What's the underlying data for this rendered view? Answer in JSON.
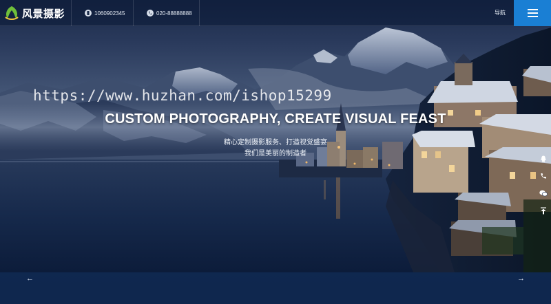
{
  "brand": {
    "name": "风景摄影"
  },
  "header": {
    "phone_mobile": "1060902345",
    "phone_landline": "020-88888888",
    "nav_label": "导航"
  },
  "watermark": "https://www.huzhan.com/ishop15299",
  "hero": {
    "headline": "CUSTOM PHOTOGRAPHY, CREATE VISUAL FEAST",
    "subline_1": "精心定制摄影服务、打造视觉盛宴",
    "subline_2": "我们是美丽的制造者"
  },
  "slider": {
    "prev_label": "←",
    "next_label": "→"
  },
  "colors": {
    "accent": "#1a7fd4",
    "header_bg": "#0a1834",
    "bottom_bar": "#102a54"
  },
  "icons": {
    "brand": "leaf-logo-icon",
    "mobile": "mobile-phone-icon",
    "landline": "telephone-icon",
    "menu": "hamburger-menu-icon",
    "float": [
      "qq-icon",
      "phone-icon",
      "wechat-icon",
      "back-to-top-icon"
    ]
  }
}
